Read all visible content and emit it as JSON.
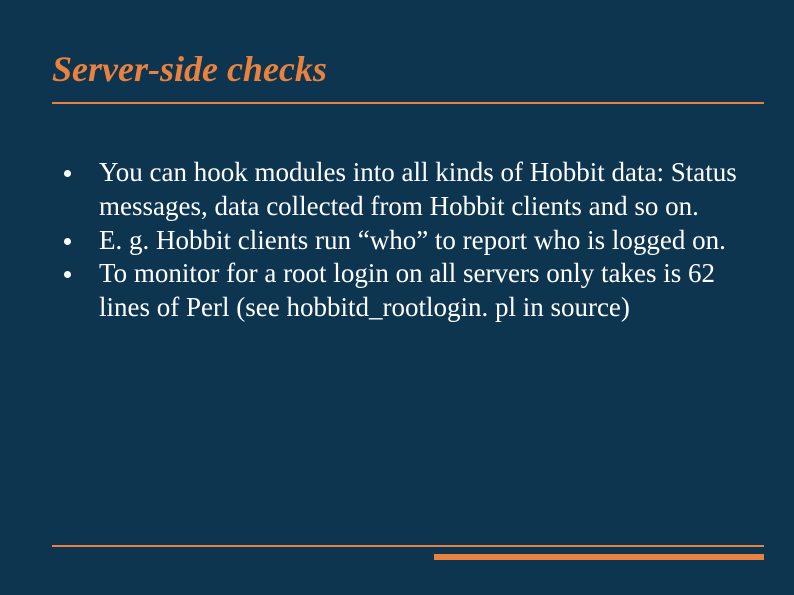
{
  "title": "Server-side checks",
  "bullets": [
    "You can hook modules into all kinds of Hobbit data: Status messages, data collected from Hobbit clients and so on.",
    "E. g. Hobbit clients run “who” to report who is logged on.",
    "To monitor for a root login on all servers only takes is 62 lines of Perl (see hobbitd_rootlogin. pl in source)"
  ]
}
